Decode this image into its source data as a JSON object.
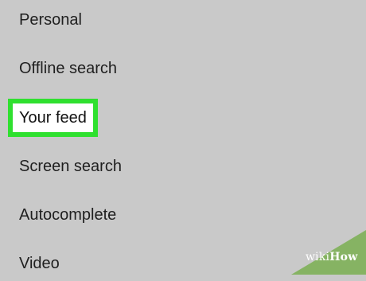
{
  "settings": {
    "items": [
      {
        "label": "Personal"
      },
      {
        "label": "Offline search"
      },
      {
        "label": "Your feed"
      },
      {
        "label": "Screen search"
      },
      {
        "label": "Autocomplete"
      },
      {
        "label": "Video"
      }
    ],
    "highlighted_index": 2
  },
  "watermark": {
    "wiki": "wiki",
    "how": "How"
  },
  "colors": {
    "background": "#c9c9c9",
    "highlight_border": "#2fe02f",
    "highlight_fill": "#ffffff",
    "text": "#1f1f1f",
    "watermark_green": "#86b363"
  }
}
